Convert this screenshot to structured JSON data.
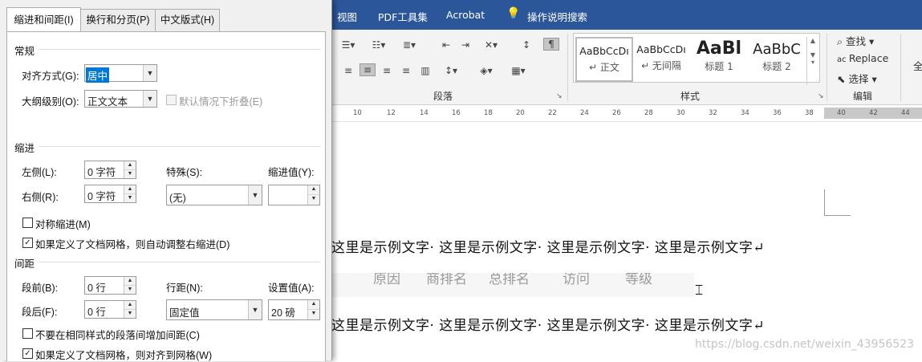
{
  "ribbon": {
    "menu_items": [
      "视图",
      "PDF工具集",
      "Acrobat",
      "操作说明搜索"
    ],
    "group_paragraph": "段落",
    "group_styles": "样式",
    "group_edit": "编辑",
    "styles": [
      {
        "sample": "AaBbCcDı",
        "name": "↵ 正文"
      },
      {
        "sample": "AaBbCcDı",
        "name": "↵ 无间隔"
      },
      {
        "sample": "AaBl",
        "name": "标题 1"
      },
      {
        "sample": "AaBbC",
        "name": "标题 2"
      }
    ],
    "edit": {
      "find": "查找",
      "replace": "Replace",
      "select": "选择"
    },
    "cut_off_label": "全"
  },
  "ruler": {
    "marks": [
      "10",
      "12",
      "14",
      "16",
      "18",
      "20",
      "22",
      "24",
      "26",
      "28",
      "30",
      "32",
      "34",
      "36",
      "38",
      "40",
      "42",
      "44"
    ]
  },
  "document": {
    "line1": "这里是示例文字· 这里是示例文字· 这里是示例文字· 这里是示例文字↵",
    "faded": [
      "原因",
      "商排名",
      "总排名",
      "访问",
      "等级"
    ],
    "line2": "这里是示例文字· 这里是示例文字· 这里是示例文字· 这里是示例文字↵",
    "watermark": "https://blog.csdn.net/weixin_43956523"
  },
  "dialog": {
    "tabs": [
      "缩进和间距(I)",
      "换行和分页(P)",
      "中文版式(H)"
    ],
    "general": {
      "title": "常规",
      "align_label": "对齐方式(G):",
      "align_value": "居中",
      "outline_label": "大纲级别(O):",
      "outline_value": "正文文本",
      "collapse_label": "默认情况下折叠(E)"
    },
    "indent": {
      "title": "缩进",
      "left_label": "左侧(L):",
      "left_value": "0 字符",
      "right_label": "右侧(R):",
      "right_value": "0 字符",
      "special_label": "特殊(S):",
      "special_value": "(无)",
      "by_label": "缩进值(Y):",
      "mirror_label": "对称缩进(M)",
      "auto_label": "如果定义了文档网格，则自动调整右缩进(D)"
    },
    "spacing": {
      "title": "间距",
      "before_label": "段前(B):",
      "before_value": "0 行",
      "after_label": "段后(F):",
      "after_value": "0 行",
      "line_label": "行距(N):",
      "line_value": "固定值",
      "at_label": "设置值(A):",
      "at_value": "20 磅",
      "nosame_label": "不要在相同样式的段落间增加间距(C)",
      "grid_label": "如果定义了文档网格，则对齐到网格(W)"
    }
  }
}
